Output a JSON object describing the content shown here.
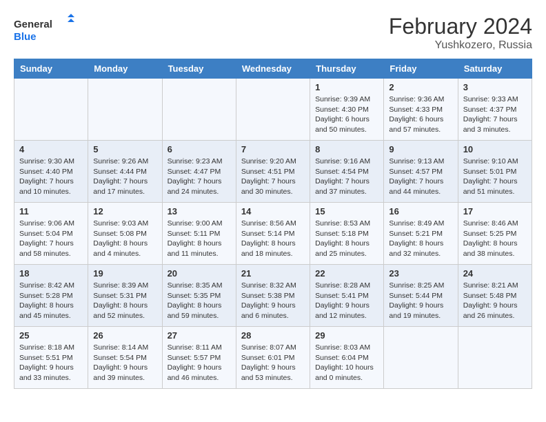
{
  "header": {
    "logo_general": "General",
    "logo_blue": "Blue",
    "month_title": "February 2024",
    "location": "Yushkozero, Russia"
  },
  "weekdays": [
    "Sunday",
    "Monday",
    "Tuesday",
    "Wednesday",
    "Thursday",
    "Friday",
    "Saturday"
  ],
  "weeks": [
    [
      {
        "day": "",
        "info": ""
      },
      {
        "day": "",
        "info": ""
      },
      {
        "day": "",
        "info": ""
      },
      {
        "day": "",
        "info": ""
      },
      {
        "day": "1",
        "info": "Sunrise: 9:39 AM\nSunset: 4:30 PM\nDaylight: 6 hours\nand 50 minutes."
      },
      {
        "day": "2",
        "info": "Sunrise: 9:36 AM\nSunset: 4:33 PM\nDaylight: 6 hours\nand 57 minutes."
      },
      {
        "day": "3",
        "info": "Sunrise: 9:33 AM\nSunset: 4:37 PM\nDaylight: 7 hours\nand 3 minutes."
      }
    ],
    [
      {
        "day": "4",
        "info": "Sunrise: 9:30 AM\nSunset: 4:40 PM\nDaylight: 7 hours\nand 10 minutes."
      },
      {
        "day": "5",
        "info": "Sunrise: 9:26 AM\nSunset: 4:44 PM\nDaylight: 7 hours\nand 17 minutes."
      },
      {
        "day": "6",
        "info": "Sunrise: 9:23 AM\nSunset: 4:47 PM\nDaylight: 7 hours\nand 24 minutes."
      },
      {
        "day": "7",
        "info": "Sunrise: 9:20 AM\nSunset: 4:51 PM\nDaylight: 7 hours\nand 30 minutes."
      },
      {
        "day": "8",
        "info": "Sunrise: 9:16 AM\nSunset: 4:54 PM\nDaylight: 7 hours\nand 37 minutes."
      },
      {
        "day": "9",
        "info": "Sunrise: 9:13 AM\nSunset: 4:57 PM\nDaylight: 7 hours\nand 44 minutes."
      },
      {
        "day": "10",
        "info": "Sunrise: 9:10 AM\nSunset: 5:01 PM\nDaylight: 7 hours\nand 51 minutes."
      }
    ],
    [
      {
        "day": "11",
        "info": "Sunrise: 9:06 AM\nSunset: 5:04 PM\nDaylight: 7 hours\nand 58 minutes."
      },
      {
        "day": "12",
        "info": "Sunrise: 9:03 AM\nSunset: 5:08 PM\nDaylight: 8 hours\nand 4 minutes."
      },
      {
        "day": "13",
        "info": "Sunrise: 9:00 AM\nSunset: 5:11 PM\nDaylight: 8 hours\nand 11 minutes."
      },
      {
        "day": "14",
        "info": "Sunrise: 8:56 AM\nSunset: 5:14 PM\nDaylight: 8 hours\nand 18 minutes."
      },
      {
        "day": "15",
        "info": "Sunrise: 8:53 AM\nSunset: 5:18 PM\nDaylight: 8 hours\nand 25 minutes."
      },
      {
        "day": "16",
        "info": "Sunrise: 8:49 AM\nSunset: 5:21 PM\nDaylight: 8 hours\nand 32 minutes."
      },
      {
        "day": "17",
        "info": "Sunrise: 8:46 AM\nSunset: 5:25 PM\nDaylight: 8 hours\nand 38 minutes."
      }
    ],
    [
      {
        "day": "18",
        "info": "Sunrise: 8:42 AM\nSunset: 5:28 PM\nDaylight: 8 hours\nand 45 minutes."
      },
      {
        "day": "19",
        "info": "Sunrise: 8:39 AM\nSunset: 5:31 PM\nDaylight: 8 hours\nand 52 minutes."
      },
      {
        "day": "20",
        "info": "Sunrise: 8:35 AM\nSunset: 5:35 PM\nDaylight: 8 hours\nand 59 minutes."
      },
      {
        "day": "21",
        "info": "Sunrise: 8:32 AM\nSunset: 5:38 PM\nDaylight: 9 hours\nand 6 minutes."
      },
      {
        "day": "22",
        "info": "Sunrise: 8:28 AM\nSunset: 5:41 PM\nDaylight: 9 hours\nand 12 minutes."
      },
      {
        "day": "23",
        "info": "Sunrise: 8:25 AM\nSunset: 5:44 PM\nDaylight: 9 hours\nand 19 minutes."
      },
      {
        "day": "24",
        "info": "Sunrise: 8:21 AM\nSunset: 5:48 PM\nDaylight: 9 hours\nand 26 minutes."
      }
    ],
    [
      {
        "day": "25",
        "info": "Sunrise: 8:18 AM\nSunset: 5:51 PM\nDaylight: 9 hours\nand 33 minutes."
      },
      {
        "day": "26",
        "info": "Sunrise: 8:14 AM\nSunset: 5:54 PM\nDaylight: 9 hours\nand 39 minutes."
      },
      {
        "day": "27",
        "info": "Sunrise: 8:11 AM\nSunset: 5:57 PM\nDaylight: 9 hours\nand 46 minutes."
      },
      {
        "day": "28",
        "info": "Sunrise: 8:07 AM\nSunset: 6:01 PM\nDaylight: 9 hours\nand 53 minutes."
      },
      {
        "day": "29",
        "info": "Sunrise: 8:03 AM\nSunset: 6:04 PM\nDaylight: 10 hours\nand 0 minutes."
      },
      {
        "day": "",
        "info": ""
      },
      {
        "day": "",
        "info": ""
      }
    ]
  ]
}
